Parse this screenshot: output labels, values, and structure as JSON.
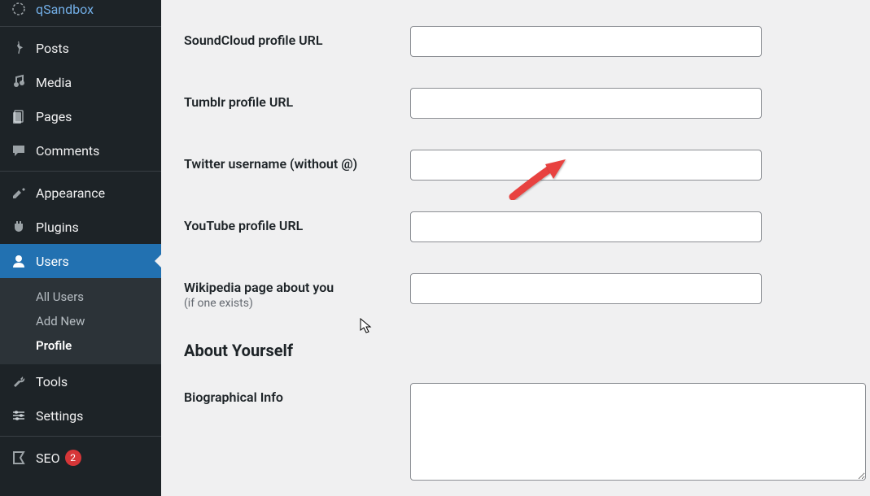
{
  "sidebar": {
    "top_partial": "qSandbox",
    "items": [
      {
        "label": "Posts",
        "icon": "pin-icon"
      },
      {
        "label": "Media",
        "icon": "media-icon"
      },
      {
        "label": "Pages",
        "icon": "pages-icon"
      },
      {
        "label": "Comments",
        "icon": "comments-icon"
      }
    ],
    "items2": [
      {
        "label": "Appearance",
        "icon": "appearance-icon"
      },
      {
        "label": "Plugins",
        "icon": "plugins-icon"
      },
      {
        "label": "Users",
        "icon": "users-icon",
        "current": true
      }
    ],
    "submenu": [
      {
        "label": "All Users"
      },
      {
        "label": "Add New"
      },
      {
        "label": "Profile",
        "current": true
      }
    ],
    "items3": [
      {
        "label": "Tools",
        "icon": "tools-icon"
      },
      {
        "label": "Settings",
        "icon": "settings-icon"
      }
    ],
    "items4": [
      {
        "label": "SEO",
        "icon": "seo-icon",
        "badge": "2"
      }
    ]
  },
  "form": {
    "fields": [
      {
        "label": "SoundCloud profile URL",
        "value": ""
      },
      {
        "label": "Tumblr profile URL",
        "value": ""
      },
      {
        "label": "Twitter username (without @)",
        "value": ""
      },
      {
        "label": "YouTube profile URL",
        "value": ""
      },
      {
        "label": "Wikipedia page about you",
        "sublabel": "(if one exists)",
        "value": ""
      }
    ],
    "section_heading": "About Yourself",
    "bio_label": "Biographical Info",
    "bio_value": ""
  }
}
